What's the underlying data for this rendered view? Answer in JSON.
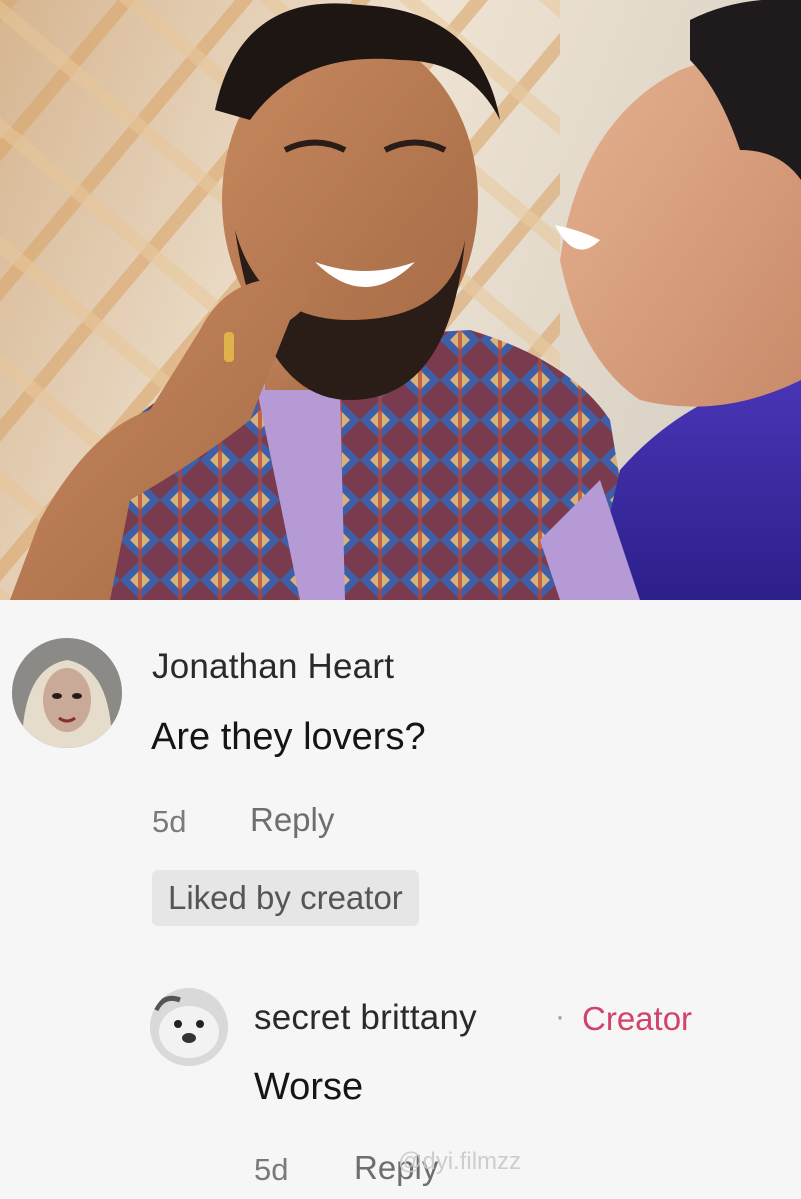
{
  "comments": [
    {
      "username": "Jonathan Heart",
      "text": "Are they lovers?",
      "age": "5d",
      "reply_label": "Reply",
      "badge": "Liked by creator"
    },
    {
      "username": "secret brittany",
      "separator": "·",
      "creator_label": "Creator",
      "text": "Worse",
      "age": "5d",
      "reply_label": "Reply"
    }
  ],
  "watermark": "@dyi.filmzz",
  "colors": {
    "creator_accent": "#d2436a",
    "text_primary": "#151515",
    "text_muted": "#7a7a7a",
    "badge_bg": "#e6e6e6",
    "background": "#f6f6f6"
  }
}
